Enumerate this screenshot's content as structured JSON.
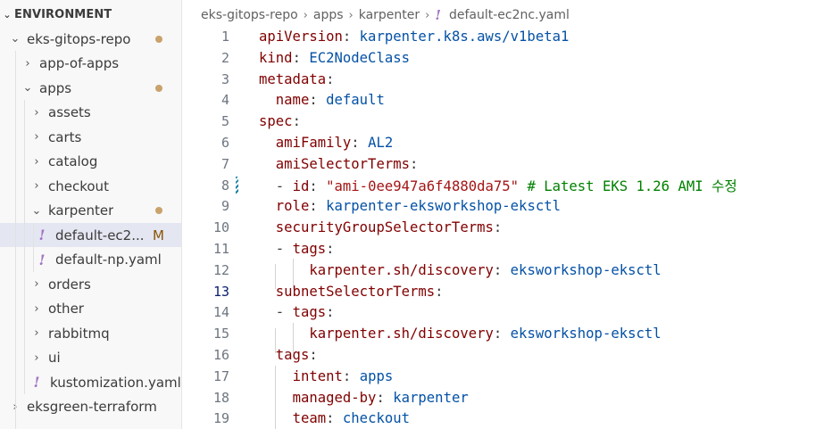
{
  "explorer": {
    "section_title": "ENVIRONMENT",
    "items": [
      {
        "label": "eks-gitops-repo",
        "type": "folder",
        "expanded": true,
        "depth": 1,
        "modified_dot": true
      },
      {
        "label": "app-of-apps",
        "type": "folder",
        "expanded": false,
        "depth": 2
      },
      {
        "label": "apps",
        "type": "folder",
        "expanded": true,
        "depth": 2,
        "modified_dot": true
      },
      {
        "label": "assets",
        "type": "folder",
        "expanded": false,
        "depth": 3
      },
      {
        "label": "carts",
        "type": "folder",
        "expanded": false,
        "depth": 3
      },
      {
        "label": "catalog",
        "type": "folder",
        "expanded": false,
        "depth": 3
      },
      {
        "label": "checkout",
        "type": "folder",
        "expanded": false,
        "depth": 3
      },
      {
        "label": "karpenter",
        "type": "folder",
        "expanded": true,
        "depth": 3,
        "modified_dot": true
      },
      {
        "label": "default-ec2...",
        "type": "yaml",
        "depth": 4,
        "selected": true,
        "badge": "M"
      },
      {
        "label": "default-np.yaml",
        "type": "yaml",
        "depth": 4
      },
      {
        "label": "orders",
        "type": "folder",
        "expanded": false,
        "depth": 3
      },
      {
        "label": "other",
        "type": "folder",
        "expanded": false,
        "depth": 3
      },
      {
        "label": "rabbitmq",
        "type": "folder",
        "expanded": false,
        "depth": 3
      },
      {
        "label": "ui",
        "type": "folder",
        "expanded": false,
        "depth": 3
      },
      {
        "label": "kustomization.yaml",
        "type": "yaml",
        "depth": 3
      },
      {
        "label": "eksgreen-terraform",
        "type": "folder",
        "expanded": false,
        "depth": 1
      }
    ]
  },
  "breadcrumb": {
    "parts": [
      "eks-gitops-repo",
      "apps",
      "karpenter"
    ],
    "file": "default-ec2nc.yaml"
  },
  "editor": {
    "active_line": 13,
    "modified_line": 8,
    "lines": [
      {
        "n": "1",
        "tokens": [
          [
            "k",
            "apiVersion"
          ],
          [
            "p",
            ": "
          ],
          [
            "v",
            "karpenter.k8s.aws/v1beta1"
          ]
        ]
      },
      {
        "n": "2",
        "tokens": [
          [
            "k",
            "kind"
          ],
          [
            "p",
            ": "
          ],
          [
            "v",
            "EC2NodeClass"
          ]
        ]
      },
      {
        "n": "3",
        "tokens": [
          [
            "k",
            "metadata"
          ],
          [
            "p",
            ":"
          ]
        ]
      },
      {
        "n": "4",
        "tokens": [
          [
            "p",
            "  "
          ],
          [
            "k",
            "name"
          ],
          [
            "p",
            ": "
          ],
          [
            "v",
            "default"
          ]
        ]
      },
      {
        "n": "5",
        "tokens": [
          [
            "k",
            "spec"
          ],
          [
            "p",
            ":"
          ]
        ]
      },
      {
        "n": "6",
        "tokens": [
          [
            "p",
            "  "
          ],
          [
            "k",
            "amiFamily"
          ],
          [
            "p",
            ": "
          ],
          [
            "v",
            "AL2"
          ]
        ]
      },
      {
        "n": "7",
        "tokens": [
          [
            "p",
            "  "
          ],
          [
            "k",
            "amiSelectorTerms"
          ],
          [
            "p",
            ":"
          ]
        ]
      },
      {
        "n": "8",
        "tokens": [
          [
            "p",
            "  - "
          ],
          [
            "k",
            "id"
          ],
          [
            "p",
            ": "
          ],
          [
            "s",
            "\"ami-0ee947a6f4880da75\""
          ],
          [
            "p",
            " "
          ],
          [
            "c",
            "# Latest EKS 1.26 AMI 수정"
          ]
        ]
      },
      {
        "n": "9",
        "tokens": [
          [
            "p",
            "  "
          ],
          [
            "k",
            "role"
          ],
          [
            "p",
            ": "
          ],
          [
            "v",
            "karpenter-eksworkshop-eksctl"
          ]
        ]
      },
      {
        "n": "10",
        "tokens": [
          [
            "p",
            "  "
          ],
          [
            "k",
            "securityGroupSelectorTerms"
          ],
          [
            "p",
            ":"
          ]
        ]
      },
      {
        "n": "11",
        "tokens": [
          [
            "p",
            "  - "
          ],
          [
            "k",
            "tags"
          ],
          [
            "p",
            ":"
          ]
        ]
      },
      {
        "n": "12",
        "tokens": [
          [
            "p",
            "      "
          ],
          [
            "k",
            "karpenter.sh/discovery"
          ],
          [
            "p",
            ": "
          ],
          [
            "v",
            "eksworkshop-eksctl"
          ]
        ]
      },
      {
        "n": "13",
        "tokens": [
          [
            "p",
            "  "
          ],
          [
            "k",
            "subnetSelectorTerms"
          ],
          [
            "p",
            ":"
          ]
        ]
      },
      {
        "n": "14",
        "tokens": [
          [
            "p",
            "  - "
          ],
          [
            "k",
            "tags"
          ],
          [
            "p",
            ":"
          ]
        ]
      },
      {
        "n": "15",
        "tokens": [
          [
            "p",
            "      "
          ],
          [
            "k",
            "karpenter.sh/discovery"
          ],
          [
            "p",
            ": "
          ],
          [
            "v",
            "eksworkshop-eksctl"
          ]
        ]
      },
      {
        "n": "16",
        "tokens": [
          [
            "p",
            "  "
          ],
          [
            "k",
            "tags"
          ],
          [
            "p",
            ":"
          ]
        ]
      },
      {
        "n": "17",
        "tokens": [
          [
            "p",
            "    "
          ],
          [
            "k",
            "intent"
          ],
          [
            "p",
            ": "
          ],
          [
            "v",
            "apps"
          ]
        ]
      },
      {
        "n": "18",
        "tokens": [
          [
            "p",
            "    "
          ],
          [
            "k",
            "managed-by"
          ],
          [
            "p",
            ": "
          ],
          [
            "v",
            "karpenter"
          ]
        ]
      },
      {
        "n": "19",
        "tokens": [
          [
            "p",
            "    "
          ],
          [
            "k",
            "team"
          ],
          [
            "p",
            ": "
          ],
          [
            "v",
            "checkout"
          ]
        ]
      }
    ]
  },
  "colors": {
    "keyword": "#800000",
    "value": "#0451a5",
    "string": "#a31515",
    "comment": "#008000",
    "yaml_icon": "#a074c4",
    "modified_dot": "#c9a26c",
    "selection": "#e4e6f1"
  }
}
